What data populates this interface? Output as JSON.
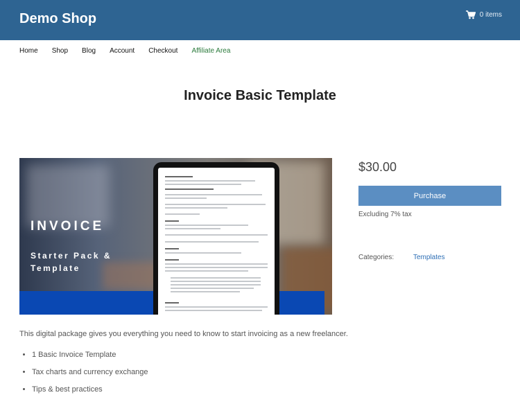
{
  "header": {
    "site_title": "Demo Shop",
    "cart_label": "0 items",
    "bg_color": "#2e6492"
  },
  "nav": {
    "items": [
      "Home",
      "Shop",
      "Blog",
      "Account",
      "Checkout",
      "Affiliate Area"
    ]
  },
  "product": {
    "title": "Invoice Basic Template",
    "image": {
      "overlay_title": "INVOICE",
      "overlay_subtitle": "Starter Pack &\nTemplate"
    },
    "price": "$30.00",
    "purchase_label": "Purchase",
    "tax_note": "Excluding 7% tax",
    "categories_label": "Categories:",
    "category": "Templates",
    "description": "This digital package gives you everything you need to know to start invoicing as a new freelancer.",
    "features": [
      "1 Basic Invoice Template",
      "Tax charts and currency exchange",
      "Tips & best practices"
    ]
  },
  "colors": {
    "button": "#5b8ec2",
    "link": "#2e6fb5",
    "affiliate": "#2a7a3b",
    "image_band": "#0a48b3"
  }
}
